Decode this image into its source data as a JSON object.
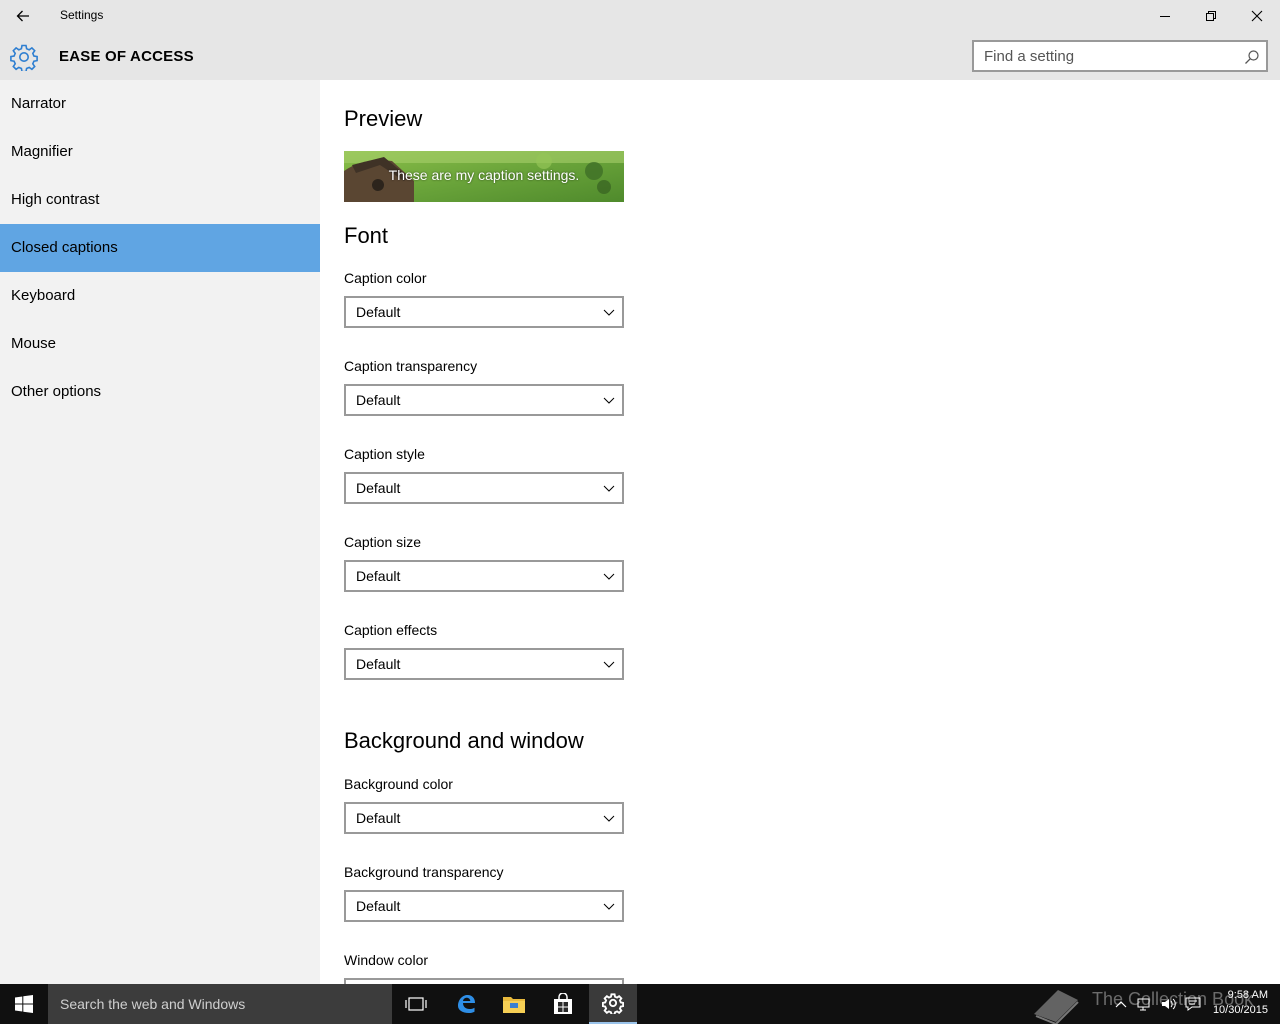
{
  "window": {
    "title": "Settings"
  },
  "header": {
    "section_title": "EASE OF ACCESS",
    "search_placeholder": "Find a setting"
  },
  "sidebar": {
    "items": [
      {
        "label": "Narrator"
      },
      {
        "label": "Magnifier"
      },
      {
        "label": "High contrast"
      },
      {
        "label": "Closed captions",
        "selected": true
      },
      {
        "label": "Keyboard"
      },
      {
        "label": "Mouse"
      },
      {
        "label": "Other options"
      }
    ]
  },
  "main": {
    "preview_heading": "Preview",
    "preview_caption": "These are my caption settings.",
    "font_heading": "Font",
    "font_settings": [
      {
        "label": "Caption color",
        "value": "Default"
      },
      {
        "label": "Caption transparency",
        "value": "Default"
      },
      {
        "label": "Caption style",
        "value": "Default"
      },
      {
        "label": "Caption size",
        "value": "Default"
      },
      {
        "label": "Caption effects",
        "value": "Default"
      }
    ],
    "background_heading": "Background and window",
    "background_settings": [
      {
        "label": "Background color",
        "value": "Default"
      },
      {
        "label": "Background transparency",
        "value": "Default"
      },
      {
        "label": "Window color",
        "value": ""
      }
    ]
  },
  "taskbar": {
    "search_placeholder": "Search the web and Windows",
    "time": "9:58 AM",
    "date": "10/30/2015",
    "watermark": "The Collection Book"
  },
  "colors": {
    "accent": "#60a5e3",
    "titlebar": "#e6e6e6",
    "sidebar": "#f2f2f2",
    "taskbar": "#101010"
  },
  "icons": [
    "back-arrow-icon",
    "minimize-icon",
    "restore-icon",
    "close-icon",
    "gear-icon",
    "search-icon",
    "chevron-down-icon",
    "windows-logo-icon",
    "task-view-icon",
    "edge-icon",
    "file-explorer-icon",
    "store-icon",
    "settings-gear-icon",
    "chevron-up-icon",
    "network-icon",
    "volume-icon",
    "action-center-icon"
  ]
}
